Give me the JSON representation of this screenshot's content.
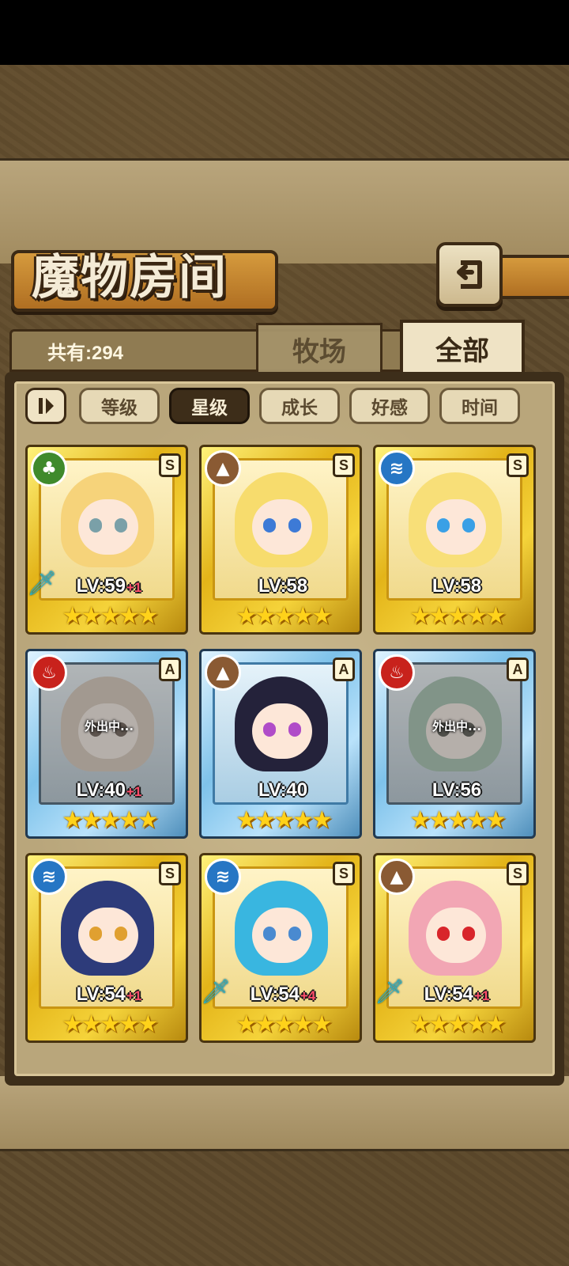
{
  "page": {
    "title": "魔物房间",
    "count_label": "共有:294"
  },
  "tabs": {
    "ranch": "牧场",
    "all": "全部"
  },
  "filters": [
    {
      "label": "等级",
      "active": false
    },
    {
      "label": "星级",
      "active": true
    },
    {
      "label": "成长",
      "active": false
    },
    {
      "label": "好感",
      "active": false
    },
    {
      "label": "时间",
      "active": false
    }
  ],
  "cards": [
    {
      "level": "LV:59",
      "bonus": "+1",
      "rank": "S",
      "element": "nature-icon",
      "frame": "gold",
      "stars": "★★★★★",
      "status": "",
      "weapon": true,
      "hair": "#f6d37a",
      "eyes": "#7aa0a8"
    },
    {
      "level": "LV:58",
      "bonus": "",
      "rank": "S",
      "element": "earth-icon",
      "frame": "gold",
      "stars": "★★★★★",
      "status": "",
      "weapon": false,
      "hair": "#f7dc6d",
      "eyes": "#3d7ad6"
    },
    {
      "level": "LV:58",
      "bonus": "",
      "rank": "S",
      "element": "water-icon",
      "frame": "gold",
      "stars": "★★★★★",
      "status": "",
      "weapon": false,
      "hair": "#f8df78",
      "eyes": "#3aa0e6"
    },
    {
      "level": "LV:40",
      "bonus": "+1",
      "rank": "A",
      "element": "fire-icon",
      "frame": "blue",
      "stars": "★★★★★",
      "status": "外出中...",
      "weapon": false,
      "hair": "#e8c9ac",
      "eyes": "#8a6d5a"
    },
    {
      "level": "LV:40",
      "bonus": "",
      "rank": "A",
      "element": "earth-icon",
      "frame": "blue",
      "stars": "★★★★★",
      "status": "",
      "weapon": false,
      "hair": "#24223a",
      "eyes": "#b04cc8"
    },
    {
      "level": "LV:56",
      "bonus": "",
      "rank": "A",
      "element": "fire-icon",
      "frame": "blue",
      "stars": "★★★★★",
      "status": "外出中...",
      "weapon": false,
      "hair": "#8fd0a8",
      "eyes": "#6a6a5a"
    },
    {
      "level": "LV:54",
      "bonus": "+1",
      "rank": "S",
      "element": "water-icon",
      "frame": "gold",
      "stars": "★★★★★",
      "status": "",
      "weapon": false,
      "hair": "#2d3b7a",
      "eyes": "#e0a030"
    },
    {
      "level": "LV:54",
      "bonus": "+4",
      "rank": "S",
      "element": "water-icon",
      "frame": "gold",
      "stars": "★★★★★",
      "status": "",
      "weapon": true,
      "hair": "#39b6e0",
      "eyes": "#4a8ad0"
    },
    {
      "level": "LV:54",
      "bonus": "+1",
      "rank": "S",
      "element": "earth-icon",
      "frame": "gold",
      "stars": "★★★★★",
      "status": "",
      "weapon": true,
      "hair": "#f2a6b4",
      "eyes": "#d8252b"
    }
  ]
}
